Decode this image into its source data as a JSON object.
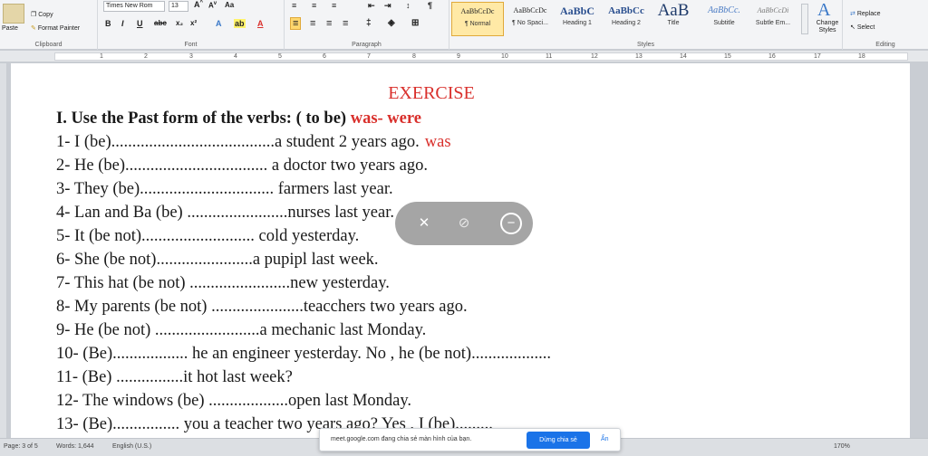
{
  "ribbon": {
    "clipboard": {
      "label": "Clipboard",
      "paste": "Paste",
      "copy": "Copy",
      "format_painter": "Format Painter"
    },
    "font": {
      "label": "Font",
      "name": "Times New Rom",
      "size": "13"
    },
    "paragraph": {
      "label": "Paragraph"
    },
    "styles": {
      "label": "Styles",
      "items": [
        {
          "preview": "AaBbCcDc",
          "name": "¶ Normal"
        },
        {
          "preview": "AaBbCcDc",
          "name": "¶ No Spaci..."
        },
        {
          "preview": "AaBbC",
          "name": "Heading 1"
        },
        {
          "preview": "AaBbCc",
          "name": "Heading 2"
        },
        {
          "preview": "AaB",
          "name": "Title"
        },
        {
          "preview": "AaBbCc.",
          "name": "Subtitle"
        },
        {
          "preview": "AaBbCcDi",
          "name": "Subtle Em..."
        }
      ],
      "change_styles": "Change Styles"
    },
    "editing": {
      "label": "Editing",
      "replace": "Replace",
      "select": "Select"
    }
  },
  "ruler": {
    "numbers": [
      "1",
      "2",
      "3",
      "4",
      "5",
      "6",
      "7",
      "8",
      "9",
      "10",
      "11",
      "12",
      "13",
      "14",
      "15",
      "16",
      "17",
      "18"
    ]
  },
  "document": {
    "title": "EXERCISE",
    "heading": "I. Use the Past form of the verbs: ( to be)",
    "heading_answer": "was- were",
    "lines": [
      {
        "text": "1- I (be).......................................a  student 2 years ago.",
        "answer": "was"
      },
      {
        "text": "2- He (be)..................................  a doctor two years ago.",
        "answer": ""
      },
      {
        "text": "3- They (be)................................  farmers last year.",
        "answer": ""
      },
      {
        "text": "4- Lan and Ba (be) ........................nurses last year.",
        "answer": ""
      },
      {
        "text": "5- It (be not)...........................  cold yesterday.",
        "answer": ""
      },
      {
        "text": "6- She (be not).......................a  pupipl last week.",
        "answer": ""
      },
      {
        "text": "7- This hat (be not) ........................new  yesterday.",
        "answer": ""
      },
      {
        "text": "8- My parents (be not) ......................teacchers  two years ago.",
        "answer": ""
      },
      {
        "text": "9- He (be not) .........................a  mechanic last Monday.",
        "answer": ""
      },
      {
        "text": "10- (Be)..................  he an engineer yesterday. No , he (be not)...................",
        "answer": ""
      },
      {
        "text": "11- (Be) ................it  hot last week?",
        "answer": ""
      },
      {
        "text": "12- The windows (be) ...................open  last Monday.",
        "answer": ""
      },
      {
        "text": "13- (Be)................  you a teacher two years ago? Yes , I (be).........",
        "answer": ""
      }
    ]
  },
  "status": {
    "page": "Page: 3 of 5",
    "words": "Words: 1,644",
    "language": "English (U.S.)",
    "zoom": "170%"
  },
  "share_banner": {
    "text": "meet.google.com đang chia sẻ màn hình của bạn.",
    "stop": "Dừng chia sẻ",
    "hide": "Ẩn"
  },
  "icons": [
    "paste-icon",
    "copy-icon",
    "format-painter-icon",
    "bold-icon",
    "italic-icon",
    "underline-icon",
    "mute-mic-icon",
    "camera-off-icon",
    "minimize-icon",
    "change-styles-icon",
    "replace-icon",
    "select-icon"
  ]
}
